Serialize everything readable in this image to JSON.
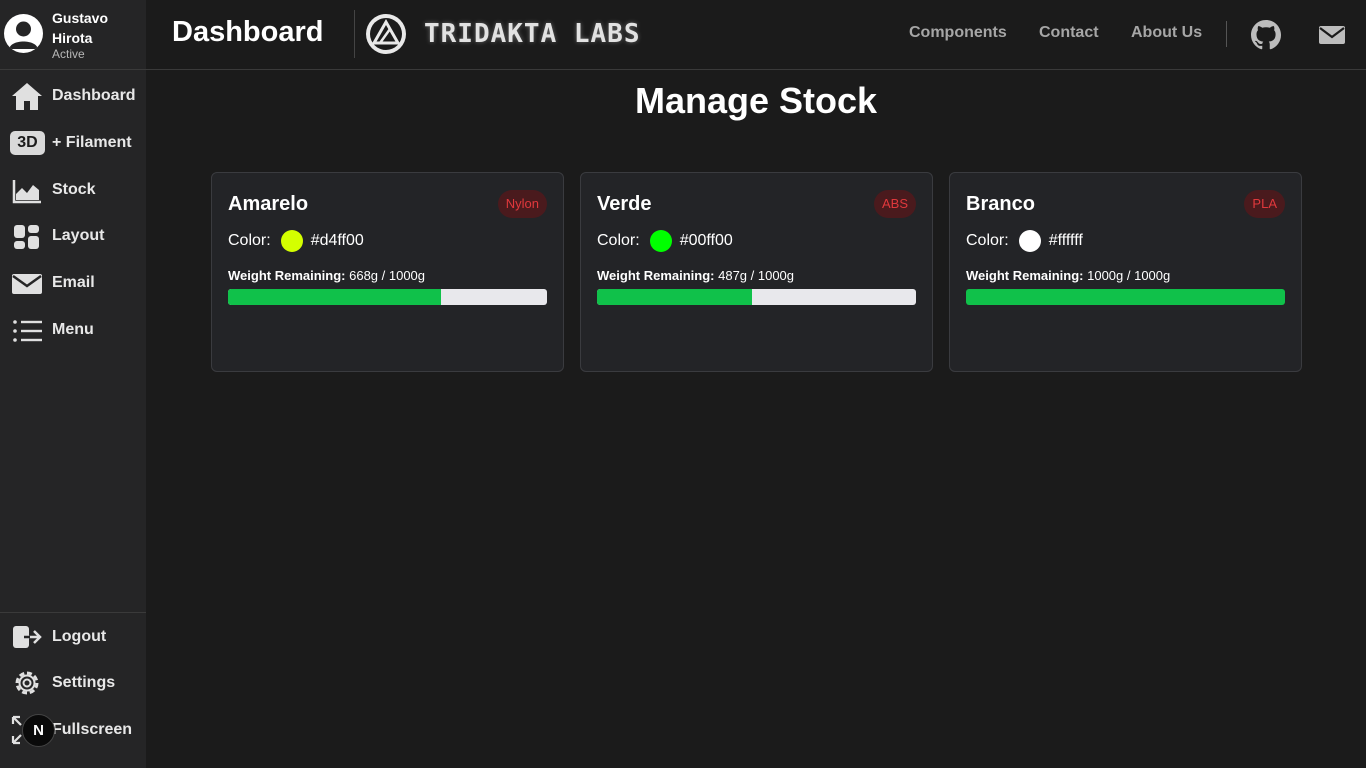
{
  "user": {
    "name": "Gustavo Hirota",
    "status": "Active"
  },
  "sidebar": {
    "items": [
      {
        "label": "Dashboard",
        "icon": "home-icon"
      },
      {
        "label": "+ Filament",
        "icon": "3d-icon",
        "badge": "3D"
      },
      {
        "label": "Stock",
        "icon": "chart-icon"
      },
      {
        "label": "Layout",
        "icon": "layout-icon"
      },
      {
        "label": "Email",
        "icon": "mail-icon"
      },
      {
        "label": "Menu",
        "icon": "list-icon"
      }
    ],
    "bottom": [
      {
        "label": "Logout",
        "icon": "logout-icon"
      },
      {
        "label": "Settings",
        "icon": "gear-icon"
      },
      {
        "label": "Fullscreen",
        "icon": "fullscreen-icon"
      }
    ],
    "dev_badge": "N"
  },
  "header": {
    "title": "Dashboard",
    "brand": "TRIDAKTA LABS",
    "links": [
      "Components",
      "Contact",
      "About Us"
    ],
    "icons": [
      "github-icon",
      "mail-icon"
    ]
  },
  "main": {
    "title": "Manage Stock",
    "cards": [
      {
        "name": "Amarelo",
        "material": "Nylon",
        "color_label": "Color:",
        "color": "#d4ff00",
        "weight_label": "Weight Remaining:",
        "weight_text": "668g / 1000g",
        "remaining": 668,
        "total": 1000
      },
      {
        "name": "Verde",
        "material": "ABS",
        "color_label": "Color:",
        "color": "#00ff00",
        "weight_label": "Weight Remaining:",
        "weight_text": "487g / 1000g",
        "remaining": 487,
        "total": 1000
      },
      {
        "name": "Branco",
        "material": "PLA",
        "color_label": "Color:",
        "color": "#ffffff",
        "weight_label": "Weight Remaining:",
        "weight_text": "1000g / 1000g",
        "remaining": 1000,
        "total": 1000
      }
    ]
  },
  "colors": {
    "background": "#1b1b1b",
    "sidebar": "#252526",
    "progress": "#10c14a",
    "material_badge": "#e0383c"
  }
}
